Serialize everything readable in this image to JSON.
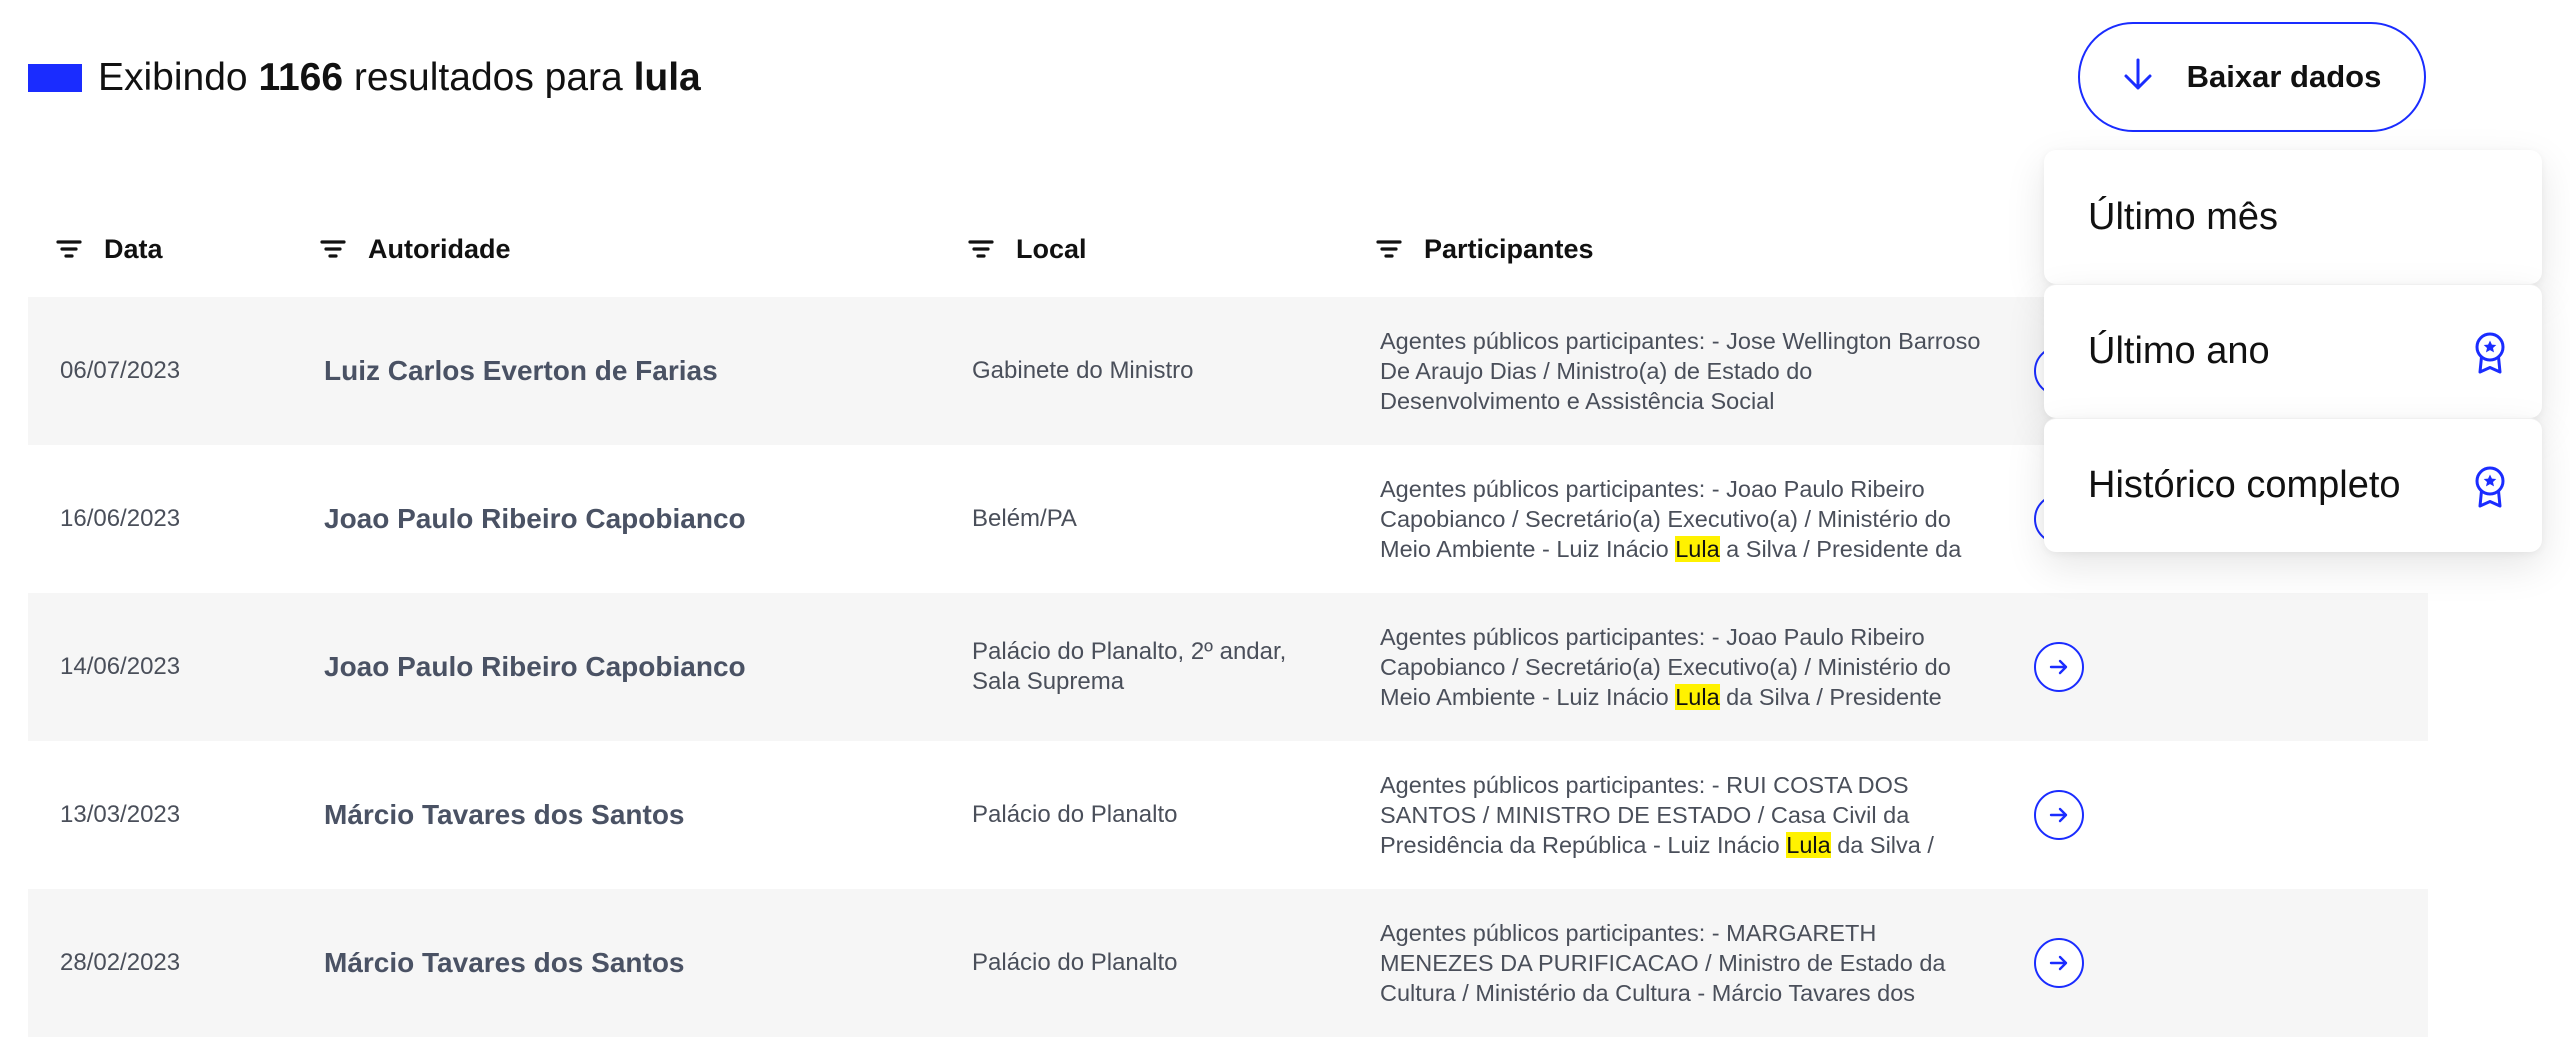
{
  "header": {
    "prefix": "Exibindo ",
    "count": "1166",
    "middle": " resultados para ",
    "query": "lula",
    "accent_color": "#1a2cff"
  },
  "download": {
    "label": "Baixar dados",
    "icon": "arrow-down-icon"
  },
  "columns": [
    {
      "label": "Data",
      "icon": "filter-icon"
    },
    {
      "label": "Autoridade",
      "icon": "filter-icon"
    },
    {
      "label": "Local",
      "icon": "filter-icon"
    },
    {
      "label": "Participantes",
      "icon": "filter-icon"
    }
  ],
  "rows": [
    {
      "date": "06/07/2023",
      "authority": "Luiz Carlos Everton de Farias",
      "local": "Gabinete do Ministro",
      "participants_pre": "Agentes públicos participantes: - Jose Wellington Barroso De Araujo Dias / Ministro(a) de Estado do Desenvolvimento e Assistência Social",
      "participants_hl": "",
      "participants_post": ""
    },
    {
      "date": "16/06/2023",
      "authority": "Joao Paulo Ribeiro Capobianco",
      "local": "Belém/PA",
      "participants_pre": "Agentes públicos participantes: - Joao Paulo Ribeiro Capobianco / Secretário(a) Executivo(a) / Ministério do Meio Ambiente - Luiz Inácio ",
      "participants_hl": "Lula",
      "participants_post": " a Silva / Presidente da"
    },
    {
      "date": "14/06/2023",
      "authority": "Joao Paulo Ribeiro Capobianco",
      "local": "Palácio do Planalto, 2º andar, Sala Suprema",
      "participants_pre": "Agentes públicos participantes: - Joao Paulo Ribeiro Capobianco / Secretário(a) Executivo(a) / Ministério do Meio Ambiente - Luiz Inácio ",
      "participants_hl": "Lula",
      "participants_post": " da Silva / Presidente"
    },
    {
      "date": "13/03/2023",
      "authority": "Márcio Tavares dos Santos",
      "local": "Palácio do Planalto",
      "participants_pre": "Agentes públicos participantes: - RUI COSTA DOS SANTOS / MINISTRO DE ESTADO / Casa Civil da Presidência da República - Luiz Inácio ",
      "participants_hl": "Lula",
      "participants_post": " da Silva /"
    },
    {
      "date": "28/02/2023",
      "authority": "Márcio Tavares dos Santos",
      "local": "Palácio do Planalto",
      "participants_pre": "Agentes públicos participantes: - MARGARETH MENEZES DA PURIFICACAO / Ministro de Estado da Cultura / Ministério da Cultura - Márcio Tavares dos",
      "participants_hl": "",
      "participants_post": ""
    }
  ],
  "dropdown": {
    "items": [
      {
        "label": "Último mês",
        "badge": ""
      },
      {
        "label": "Último ano",
        "badge": "premium-badge-icon"
      },
      {
        "label": "Histórico completo",
        "badge": "premium-badge-icon"
      }
    ]
  },
  "colors": {
    "accent": "#1a2cff",
    "highlight": "#fff200",
    "row_shade": "#f6f6f6"
  }
}
